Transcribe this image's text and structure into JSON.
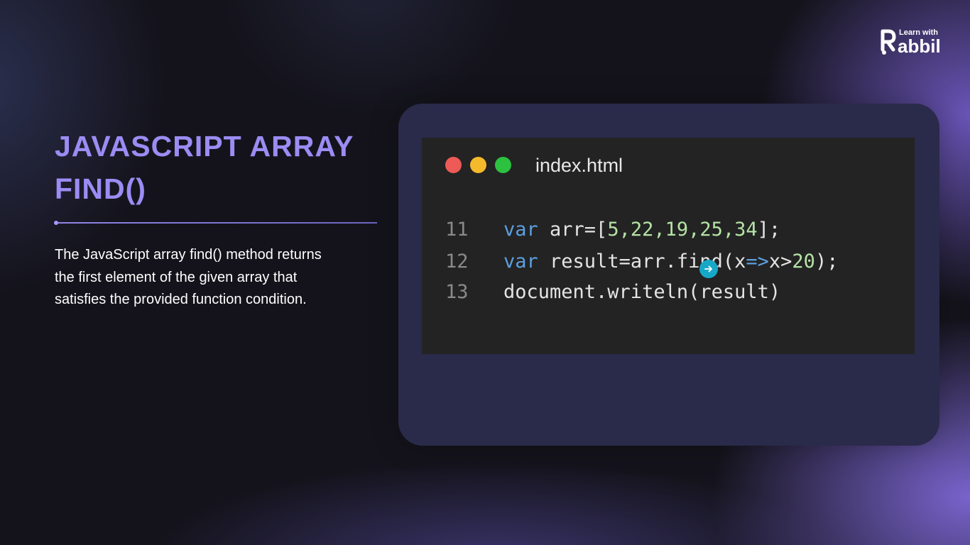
{
  "brand": {
    "tagline": "Learn with",
    "name": "Rabbil",
    "name_rest": "abbil",
    "color": "#ffffff"
  },
  "slide": {
    "title_line1": "JAVASCRIPT ARRAY",
    "title_line2": "FIND()",
    "title_color": "#9b8cf4",
    "description_line1": "The JavaScript array find() method returns",
    "description_line2": "the first element of the given array that",
    "description_line3": "satisfies the provided function condition."
  },
  "editor": {
    "window_buttons": [
      "close-dot",
      "minimize-dot",
      "maximize-dot"
    ],
    "filename": "index.html",
    "lines": [
      {
        "number": "11",
        "kw": "var",
        "rest_a": " arr=[",
        "nums": "5,22,19,25,34",
        "rest_b": "];"
      },
      {
        "number": "12",
        "kw": "var",
        "rest_a": " result=arr.find(x",
        "arrow": "=>",
        "rest_b": "x>",
        "num": "20",
        "rest_c": ");"
      },
      {
        "number": "13",
        "text": "document.writeln(result)"
      }
    ],
    "colors": {
      "keyword": "#5d9fe0",
      "number": "#b5e3a6",
      "text": "#e4e4e4",
      "line_number": "#8a8a8a",
      "background": "#232323"
    }
  },
  "cursor": {
    "icon": "arrow-right-icon",
    "color": "#17a8c8"
  }
}
